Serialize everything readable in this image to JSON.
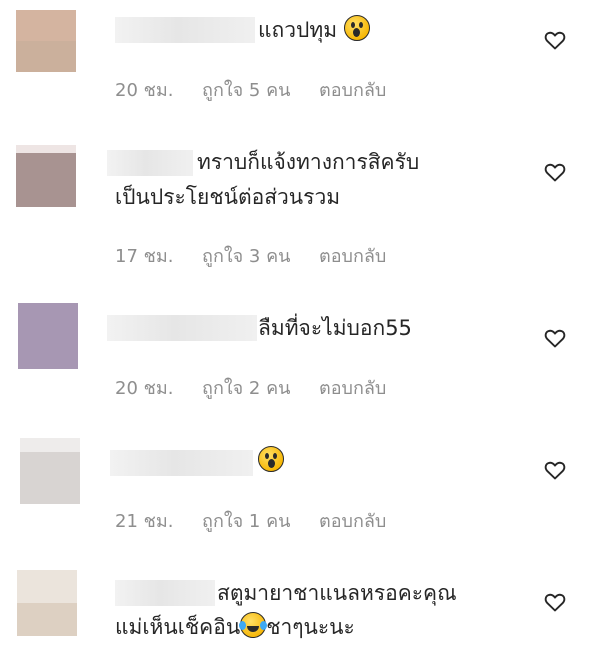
{
  "comments": [
    {
      "avatar_colors": [
        "#d4b4a0",
        "#cbb09c"
      ],
      "lines": [
        "แถวปทุม"
      ],
      "emoji": "hushed-face",
      "time": "20 ชม.",
      "likes": "ถูกใจ 5 คน",
      "reply": "ตอบกลับ"
    },
    {
      "avatar_colors": [
        "#a89391",
        "#9d8885"
      ],
      "lines": [
        "ทราบก็แจ้งทางการสิครับ",
        "เป็นประโยชน์ต่อส่วนรวม"
      ],
      "time": "17 ชม.",
      "likes": "ถูกใจ 3 คน",
      "reply": "ตอบกลับ"
    },
    {
      "avatar_colors": [
        "#a797b3",
        "#9a8aa7"
      ],
      "lines": [
        "ลืมที่จะไม่บอก55"
      ],
      "time": "20 ชม.",
      "likes": "ถูกใจ 2 คน",
      "reply": "ตอบกลับ"
    },
    {
      "avatar_colors": [
        "#e3e1e0",
        "#d8d4d2"
      ],
      "lines": [
        ""
      ],
      "emoji": "hushed-face",
      "time": "21 ชม.",
      "likes": "ถูกใจ 1 คน",
      "reply": "ตอบกลับ"
    },
    {
      "avatar_colors": [
        "#ebe4dc",
        "#ddd0c2"
      ],
      "lines": [
        "สตูมายาชาแนลหรอคะคุณ",
        "แม่เห็นเช็คอิน",
        "ชาๆนะนะ"
      ],
      "emoji": "face-with-tears-of-joy",
      "time": "",
      "likes": "",
      "reply": ""
    }
  ],
  "icons": {
    "like": "heart-outline-icon"
  }
}
